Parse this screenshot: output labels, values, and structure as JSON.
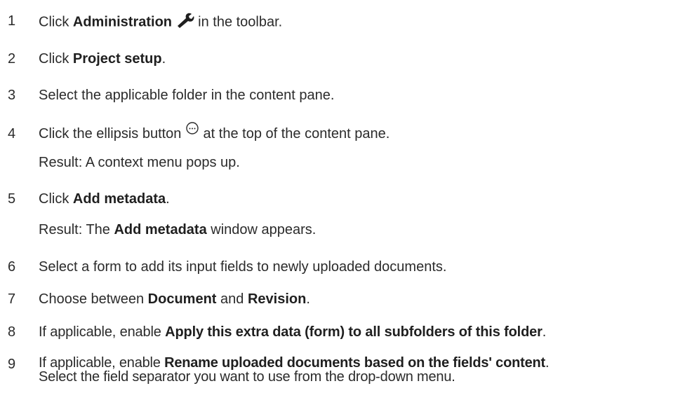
{
  "steps": [
    {
      "num": "1",
      "a": "Click ",
      "b": "Administration",
      "icon": "wrench-icon",
      "c": " in the toolbar."
    },
    {
      "num": "2",
      "a": "Click ",
      "b": "Project setup",
      "c": "."
    },
    {
      "num": "3",
      "a": "Select the applicable folder in the content pane."
    },
    {
      "num": "4",
      "a": "Click the ellipsis button ",
      "icon": "ellipsis-circle-icon",
      "c": " at the top of the content pane.",
      "result": "Result: A context menu pops up."
    },
    {
      "num": "5",
      "a": "Click ",
      "b": "Add metadata",
      "c": ".",
      "result_a": "Result: The ",
      "result_b": "Add metadata",
      "result_c": " window appears."
    },
    {
      "num": "6",
      "a": "Select a form to add its input fields to newly uploaded documents."
    },
    {
      "num": "7",
      "a": "Choose between ",
      "b": "Document",
      "c": " and ",
      "d": "Revision",
      "e": "."
    },
    {
      "num": "8",
      "a": "If applicable, enable ",
      "b": "Apply this extra data (form) to all subfolders of this folder",
      "c": "."
    },
    {
      "num": "9",
      "a": "If applicable, enable ",
      "b": "Rename uploaded documents based on the fields' content",
      "c": ".",
      "line2": "Select the field separator you want to use from the drop-down menu."
    }
  ]
}
